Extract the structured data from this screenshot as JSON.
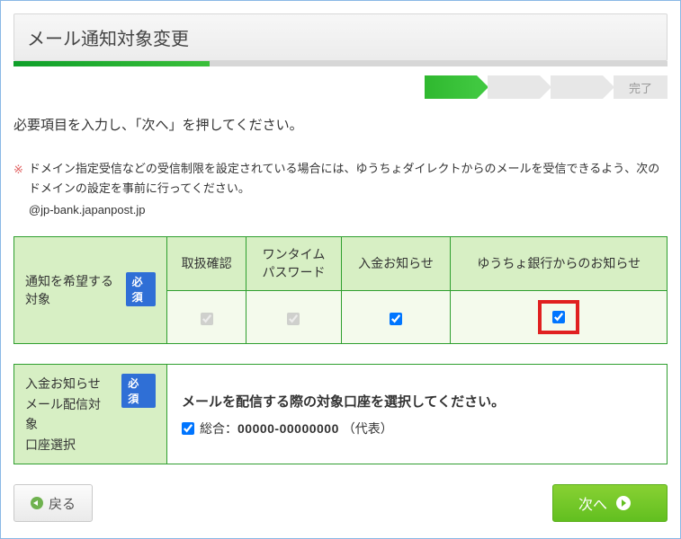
{
  "title": "メール通知対象変更",
  "steps": {
    "final_label": "完了"
  },
  "instruction_text": "必要項目を入力し、「次へ」を押してください。",
  "warning": {
    "mark": "※",
    "text": "ドメイン指定受信などの受信制限を設定されている場合には、ゆうちょダイレクトからのメールを受信できるよう、次のドメインの設定を事前に行ってください。",
    "domain": "@jp-bank.japanpost.jp"
  },
  "required_badge": "必須",
  "table1": {
    "row_label": "通知を希望する対象",
    "columns": [
      "取扱確認",
      "ワンタイム\nパスワード",
      "入金お知らせ",
      "ゆうちょ銀行からのお知らせ"
    ]
  },
  "table2": {
    "row_label": "入金お知らせ\nメール配信対象\n口座選択",
    "instruction": "メールを配信する際の対象口座を選択してください。",
    "account_prefix": "総合：",
    "account_number": "00000-00000000",
    "account_suffix": "（代表）"
  },
  "buttons": {
    "back": "戻る",
    "next": "次へ"
  }
}
